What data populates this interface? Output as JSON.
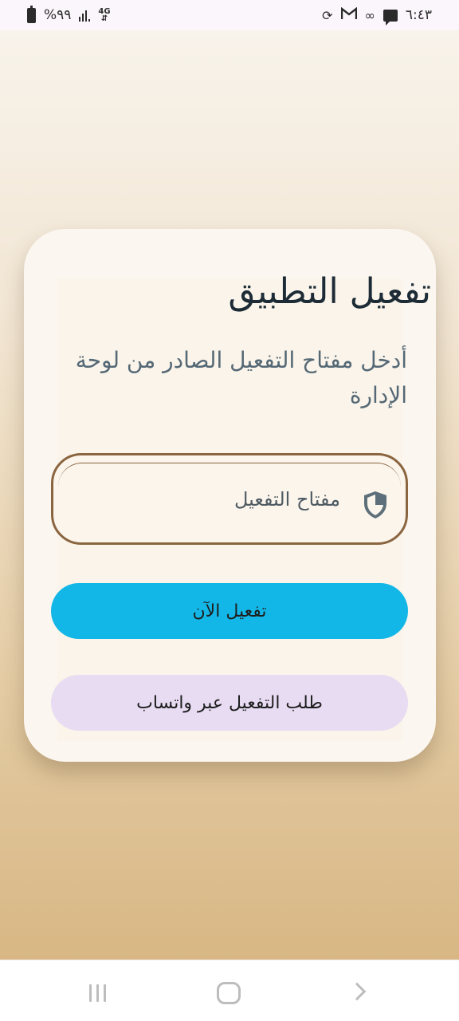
{
  "status_bar": {
    "battery_text": "%٩٩",
    "network_label": "4G",
    "time": "٦:٤٣",
    "icons": [
      "battery-icon",
      "signal-icon",
      "network-4g-icon",
      "sync-icon",
      "gmail-icon",
      "infinity-icon",
      "message-icon"
    ]
  },
  "card": {
    "title": "تفعيل التطبيق",
    "subtitle": "أدخل مفتاح التفعيل الصادر من لوحة الإدارة",
    "activation_input": {
      "placeholder": "مفتاح التفعيل",
      "value": "",
      "icon": "shield-icon"
    },
    "activate_button_label": "تفعيل الآن",
    "whatsapp_button_label": "طلب التفعيل عبر واتساب"
  },
  "colors": {
    "primary_button": "#13b7e7",
    "secondary_button": "#e7dcf2",
    "input_border": "#8a6540",
    "title_text": "#1c2b35"
  }
}
